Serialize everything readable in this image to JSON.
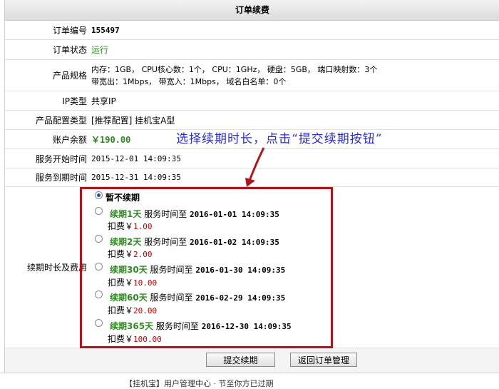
{
  "page": {
    "title": "订单续费"
  },
  "rows": {
    "order_no": {
      "label": "订单编号",
      "value": "155497"
    },
    "status": {
      "label": "订单状态",
      "value": "运行"
    },
    "spec": {
      "label": "产品规格",
      "line1": "内存：1GB， CPU核心数：1个， CPU：1GHz， 硬盘：5GB， 端口映射数：3个",
      "line2": "带宽出：1Mbps， 带宽入：1Mbps， 域名白名单：0个"
    },
    "ip": {
      "label": "IP类型",
      "value": "共享IP"
    },
    "config": {
      "label": "产品配置类型",
      "value": "[推荐配置] 挂机宝A型"
    },
    "balance": {
      "label": "账户余额",
      "value": "￥190.00"
    },
    "start": {
      "label": "服务开始时间",
      "value": "2015-12-01 14:09:35"
    },
    "end": {
      "label": "服务到期时间",
      "value": "2015-12-31 14:09:35"
    },
    "renew": {
      "label": "续期时长及费用"
    }
  },
  "annotation": "选择续期时长，点击“提交续期按钮”",
  "options": [
    {
      "label": "暂不续期",
      "checked": true
    },
    {
      "label": "续期1天",
      "service": "服务时间至",
      "time": "2016-01-01 14:09:35",
      "fee_label": "扣费￥",
      "fee": "1.00"
    },
    {
      "label": "续期2天",
      "service": "服务时间至",
      "time": "2016-01-02 14:09:35",
      "fee_label": "扣费￥",
      "fee": "2.00"
    },
    {
      "label": "续期30天",
      "service": "服务时间至",
      "time": "2016-01-30 14:09:35",
      "fee_label": "扣费￥",
      "fee": "10.00"
    },
    {
      "label": "续期60天",
      "service": "服务时间至",
      "time": "2016-02-29 14:09:35",
      "fee_label": "扣费￥",
      "fee": "20.00"
    },
    {
      "label": "续期365天",
      "service": "服务时间至",
      "time": "2016-12-30 14:09:35",
      "fee_label": "扣费￥",
      "fee": "100.00"
    }
  ],
  "buttons": {
    "submit": "提交续期",
    "back": "返回订单管理"
  },
  "footer_text": "【挂机宝】用户管理中心 · 节至你方已过期",
  "colors": {
    "accent_red": "#b0141a",
    "green": "#2e8b1f",
    "annotation_blue": "#2b2bd6"
  }
}
